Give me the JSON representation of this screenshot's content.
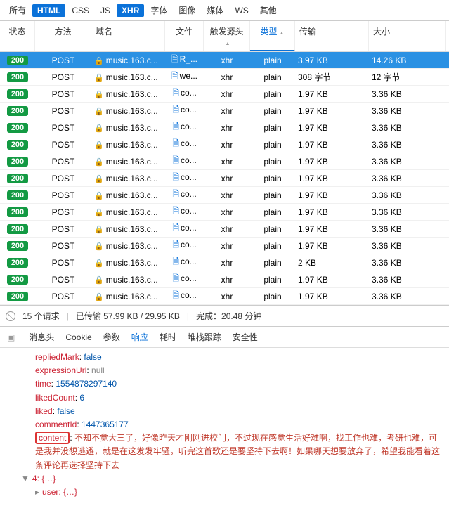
{
  "filters": {
    "all": "所有",
    "html": "HTML",
    "css": "CSS",
    "js": "JS",
    "xhr": "XHR",
    "font": "字体",
    "img": "图像",
    "media": "媒体",
    "ws": "WS",
    "other": "其他"
  },
  "columns": {
    "status": "状态",
    "method": "方法",
    "domain": "域名",
    "file": "文件",
    "initiator": "触发源头",
    "type": "类型",
    "transfer": "传输",
    "size": "大小"
  },
  "rows": [
    {
      "status": "200",
      "method": "POST",
      "domain": "music.163.c...",
      "file": "R_...",
      "init": "xhr",
      "type": "plain",
      "trans": "3.97 KB",
      "size": "14.26 KB",
      "sel": true
    },
    {
      "status": "200",
      "method": "POST",
      "domain": "music.163.c...",
      "file": "we...",
      "init": "xhr",
      "type": "plain",
      "trans": "308 字节",
      "size": "12 字节"
    },
    {
      "status": "200",
      "method": "POST",
      "domain": "music.163.c...",
      "file": "co...",
      "init": "xhr",
      "type": "plain",
      "trans": "1.97 KB",
      "size": "3.36 KB"
    },
    {
      "status": "200",
      "method": "POST",
      "domain": "music.163.c...",
      "file": "co...",
      "init": "xhr",
      "type": "plain",
      "trans": "1.97 KB",
      "size": "3.36 KB"
    },
    {
      "status": "200",
      "method": "POST",
      "domain": "music.163.c...",
      "file": "co...",
      "init": "xhr",
      "type": "plain",
      "trans": "1.97 KB",
      "size": "3.36 KB"
    },
    {
      "status": "200",
      "method": "POST",
      "domain": "music.163.c...",
      "file": "co...",
      "init": "xhr",
      "type": "plain",
      "trans": "1.97 KB",
      "size": "3.36 KB"
    },
    {
      "status": "200",
      "method": "POST",
      "domain": "music.163.c...",
      "file": "co...",
      "init": "xhr",
      "type": "plain",
      "trans": "1.97 KB",
      "size": "3.36 KB"
    },
    {
      "status": "200",
      "method": "POST",
      "domain": "music.163.c...",
      "file": "co...",
      "init": "xhr",
      "type": "plain",
      "trans": "1.97 KB",
      "size": "3.36 KB"
    },
    {
      "status": "200",
      "method": "POST",
      "domain": "music.163.c...",
      "file": "co...",
      "init": "xhr",
      "type": "plain",
      "trans": "1.97 KB",
      "size": "3.36 KB"
    },
    {
      "status": "200",
      "method": "POST",
      "domain": "music.163.c...",
      "file": "co...",
      "init": "xhr",
      "type": "plain",
      "trans": "1.97 KB",
      "size": "3.36 KB"
    },
    {
      "status": "200",
      "method": "POST",
      "domain": "music.163.c...",
      "file": "co...",
      "init": "xhr",
      "type": "plain",
      "trans": "1.97 KB",
      "size": "3.36 KB"
    },
    {
      "status": "200",
      "method": "POST",
      "domain": "music.163.c...",
      "file": "co...",
      "init": "xhr",
      "type": "plain",
      "trans": "1.97 KB",
      "size": "3.36 KB"
    },
    {
      "status": "200",
      "method": "POST",
      "domain": "music.163.c...",
      "file": "co...",
      "init": "xhr",
      "type": "plain",
      "trans": "2 KB",
      "size": "3.36 KB"
    },
    {
      "status": "200",
      "method": "POST",
      "domain": "music.163.c...",
      "file": "co...",
      "init": "xhr",
      "type": "plain",
      "trans": "1.97 KB",
      "size": "3.36 KB"
    },
    {
      "status": "200",
      "method": "POST",
      "domain": "music.163.c...",
      "file": "co...",
      "init": "xhr",
      "type": "plain",
      "trans": "1.97 KB",
      "size": "3.36 KB"
    }
  ],
  "summary": {
    "requests": "15 个请求",
    "transfer": "已传输 57.99 KB / 29.95 KB",
    "time": "完成：20.48 分钟"
  },
  "detail_tabs": {
    "headers": "消息头",
    "cookie": "Cookie",
    "params": "参数",
    "response": "响应",
    "timing": "耗时",
    "stack": "堆栈跟踪",
    "security": "安全性"
  },
  "response": {
    "repliedMark": {
      "k": "repliedMark",
      "v": "false"
    },
    "expressionUrl": {
      "k": "expressionUrl",
      "v": "null"
    },
    "time": {
      "k": "time",
      "v": "1554878297140"
    },
    "likedCount": {
      "k": "likedCount",
      "v": "6"
    },
    "liked": {
      "k": "liked",
      "v": "false"
    },
    "commentId": {
      "k": "commentId",
      "v": "1447365177"
    },
    "content": {
      "k": "content",
      "v": "不知不觉大三了，好像昨天才刚刚进校门，不过现在感觉生活好难啊，找工作也难，考研也难，可是我并没想逃避，就是在这发发牢骚，听完这首歌还是要坚持下去啊！如果哪天想要放弃了，希望我能看着这条评论再选择坚持下去"
    },
    "node4": "4: {…}",
    "nodeUser": "user: {…}"
  }
}
